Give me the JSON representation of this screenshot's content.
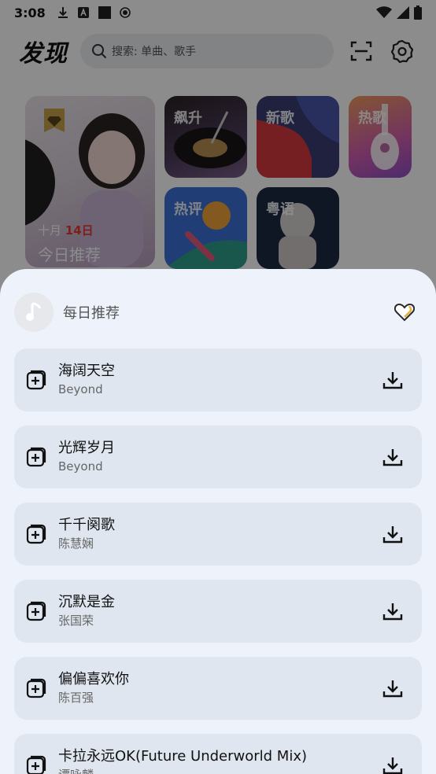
{
  "status_bar": {
    "time": "3:08"
  },
  "header": {
    "title": "发现",
    "search_placeholder": "搜索: 单曲、歌手"
  },
  "cards": {
    "daily": {
      "month": "十月",
      "day": "14日",
      "label": "今日推荐"
    },
    "soaring": "飙升",
    "new": "新歌",
    "hot": "热歌",
    "hot_comments": "热评",
    "cantonese": "粤语"
  },
  "sheet": {
    "title": "每日推荐",
    "songs": [
      {
        "title": "海阔天空",
        "artist": "Beyond"
      },
      {
        "title": "光辉岁月",
        "artist": "Beyond"
      },
      {
        "title": "千千阕歌",
        "artist": "陈慧娴"
      },
      {
        "title": "沉默是金",
        "artist": "张国荣"
      },
      {
        "title": "偏偏喜欢你",
        "artist": "陈百强"
      },
      {
        "title": "卡拉永远OK(Future Underworld Mix)",
        "artist": "谭咏麟"
      }
    ]
  },
  "colors": {
    "sheet_bg": "#eef3fb",
    "item_bg": "#dfe6f0",
    "heart_gold": "#e2b13b"
  }
}
